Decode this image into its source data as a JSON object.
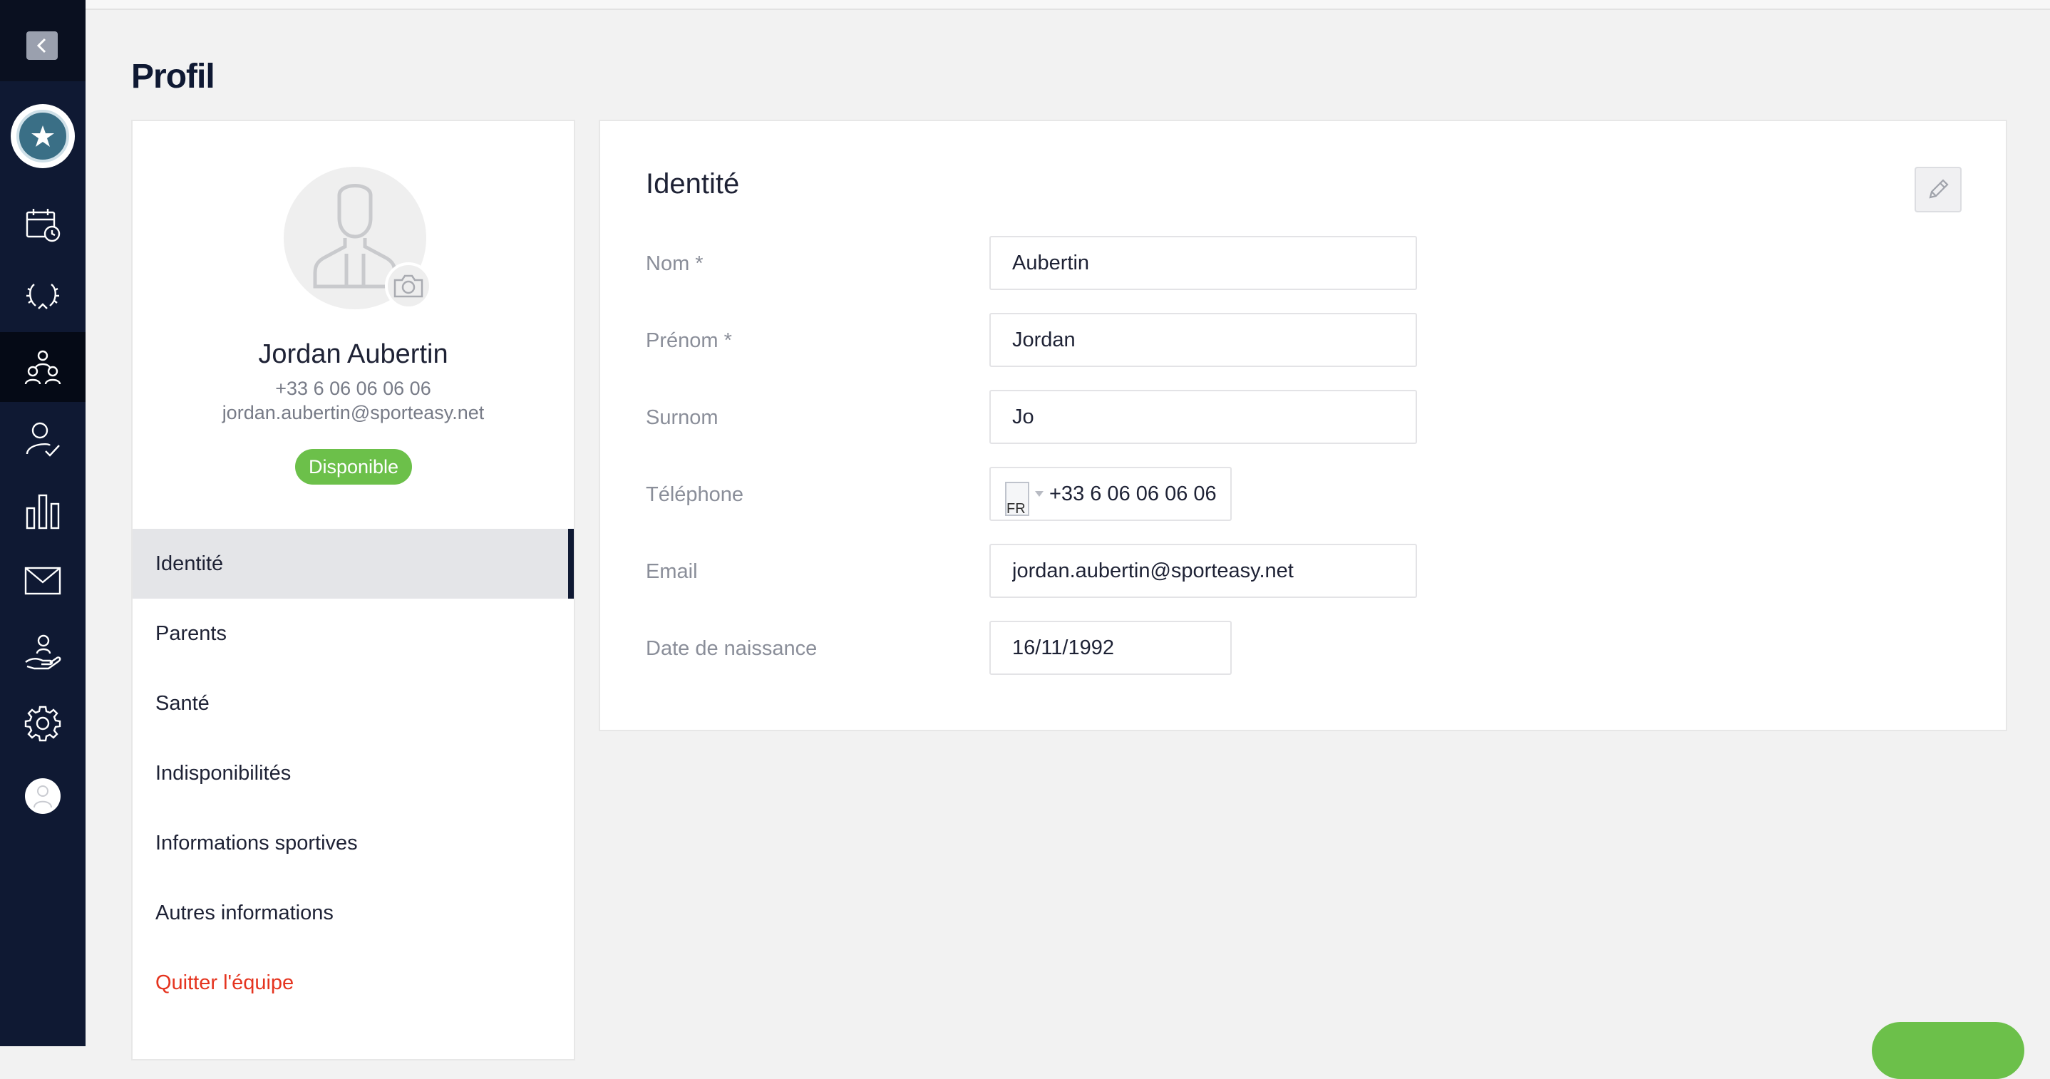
{
  "page": {
    "title": "Profil"
  },
  "sidebar": {
    "collapse_icon": "chevron-left-icon",
    "logo": "club-logo",
    "items": [
      {
        "icon": "calendar-clock-icon",
        "active": false
      },
      {
        "icon": "laurel-trophy-icon",
        "active": false
      },
      {
        "icon": "team-members-icon",
        "active": true
      },
      {
        "icon": "user-check-icon",
        "active": false
      },
      {
        "icon": "bar-chart-icon",
        "active": false
      },
      {
        "icon": "mail-icon",
        "active": false
      },
      {
        "icon": "hand-user-icon",
        "active": false
      },
      {
        "icon": "gear-icon",
        "active": false
      }
    ],
    "avatar_icon": "user-avatar-icon"
  },
  "profile": {
    "name": "Jordan Aubertin",
    "phone": "+33 6 06 06 06 06",
    "email": "jordan.aubertin@sporteasy.net",
    "status": "Disponible",
    "status_color": "#6cc04a",
    "menu": [
      {
        "label": "Identité",
        "active": true
      },
      {
        "label": "Parents",
        "active": false
      },
      {
        "label": "Santé",
        "active": false
      },
      {
        "label": "Indisponibilités",
        "active": false
      },
      {
        "label": "Informations sportives",
        "active": false
      },
      {
        "label": "Autres informations",
        "active": false
      },
      {
        "label": "Quitter l'équipe",
        "active": false,
        "danger": true
      }
    ]
  },
  "identity": {
    "title": "Identité",
    "edit_icon": "pencil-icon",
    "fields": {
      "nom": {
        "label": "Nom *",
        "value": "Aubertin"
      },
      "prenom": {
        "label": "Prénom *",
        "value": "Jordan"
      },
      "surnom": {
        "label": "Surnom",
        "value": "Jo"
      },
      "telephone": {
        "label": "Téléphone",
        "value": "+33 6 06 06 06 06",
        "flag_alt": "FR"
      },
      "email": {
        "label": "Email",
        "value": "jordan.aubertin@sporteasy.net"
      },
      "naissance": {
        "label": "Date de naissance",
        "value": "16/11/1992"
      }
    }
  },
  "colors": {
    "sidebar_bg": "#0f1933",
    "accent_green": "#6cc04a",
    "danger_red": "#e5341f",
    "page_bg": "#f2f2f2"
  }
}
